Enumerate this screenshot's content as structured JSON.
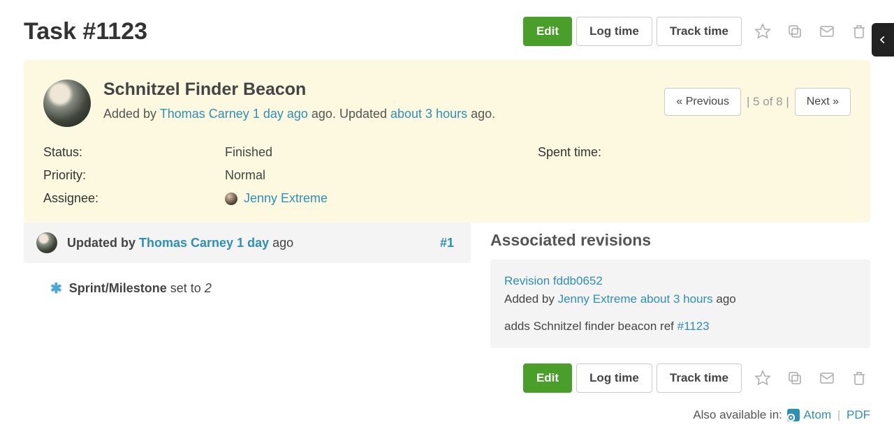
{
  "header": {
    "title": "Task #1123",
    "buttons": {
      "edit": "Edit",
      "log_time": "Log time",
      "track_time": "Track time"
    }
  },
  "issue": {
    "subject": "Schnitzel Finder Beacon",
    "meta": {
      "added_prefix": "Added by ",
      "author": "Thomas Carney",
      "author_time": "1 day ago",
      "added_suffix": " ago. Updated ",
      "updated_time": "about 3 hours",
      "updated_suffix": " ago."
    },
    "pager": {
      "prev": "« Previous",
      "count": "| 5 of 8 |",
      "next": "Next »"
    },
    "attributes": {
      "status_label": "Status:",
      "status_value": "Finished",
      "priority_label": "Priority:",
      "priority_value": "Normal",
      "assignee_label": "Assignee:",
      "assignee_value": "Jenny Extreme",
      "spent_time_label": "Spent time:"
    }
  },
  "history": {
    "prefix": "Updated by ",
    "author": "Thomas Carney",
    "time": "1 day",
    "suffix": " ago",
    "number": "#1",
    "change": {
      "field": "Sprint/Milestone",
      "text": " set to ",
      "value": "2"
    }
  },
  "associated": {
    "title": "Associated revisions",
    "revision": {
      "link": "Revision fddb0652",
      "added_prefix": "Added by ",
      "author": "Jenny Extreme",
      "time": "about 3 hours",
      "suffix": " ago",
      "message_prefix": "adds Schnitzel finder beacon ref ",
      "message_ref": "#1123"
    }
  },
  "footer_buttons": {
    "edit": "Edit",
    "log_time": "Log time",
    "track_time": "Track time"
  },
  "available": {
    "prefix": "Also available in: ",
    "atom": "Atom",
    "pdf": "PDF"
  }
}
